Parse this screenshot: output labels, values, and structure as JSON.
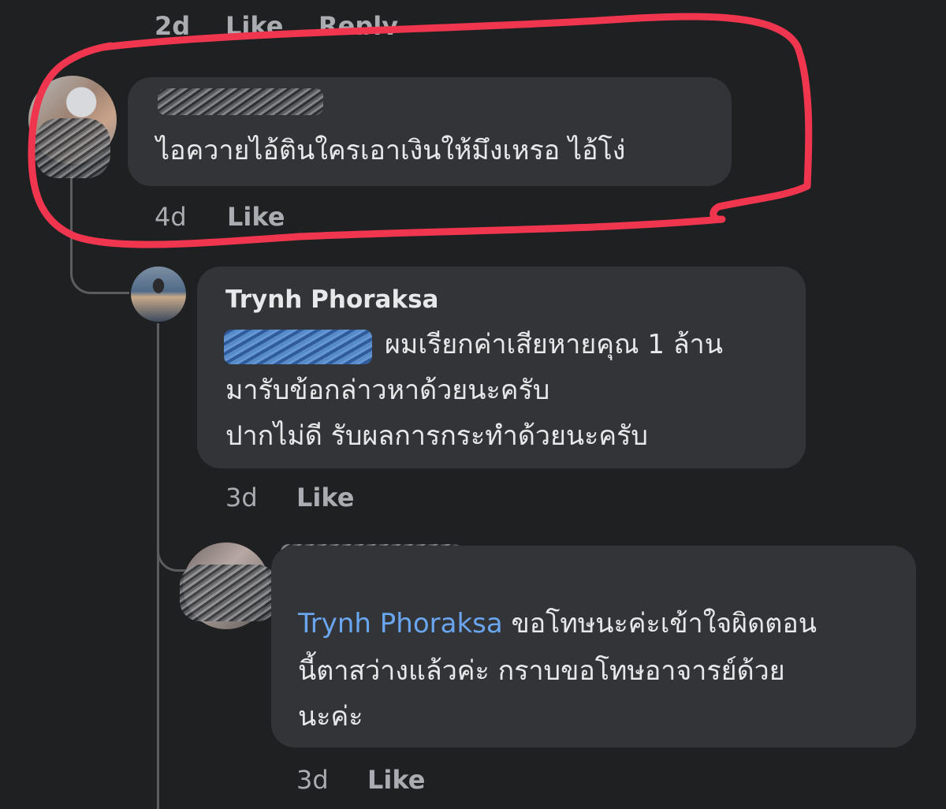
{
  "top_meta": {
    "time": "2d",
    "like_label": "Like",
    "reply_label": "Reply"
  },
  "comments": [
    {
      "author_redacted": true,
      "text_lines": [
        "ไอควายไอ้ตินใครเอาเงินให้มึงเหรอ ไอ้โง่"
      ],
      "time": "4d",
      "like_label": "Like",
      "highlighted": true
    },
    {
      "author": "Trynh Phoraksa",
      "mention_redacted": true,
      "text_lines": [
        "ผมเรียกค่าเสียหายคุณ 1 ล้าน",
        "มารับข้อกล่าวหาด้วยนะครับ",
        "ปากไม่ดี รับผลการกระทำด้วยนะครับ"
      ],
      "time": "3d",
      "like_label": "Like"
    },
    {
      "author_redacted": true,
      "mention": "Trynh Phoraksa",
      "text_lines": [
        " ขอโทษนะค่ะเข้าใจผิดตอน",
        "นี้ตาสว่างแล้วค่ะ  กราบขอโทษอาจารย์ด้วย",
        "นะค่ะ"
      ],
      "time": "3d",
      "like_label": "Like"
    }
  ],
  "colors": {
    "background": "#1f2022",
    "bubble": "#333437",
    "text": "#e6e8ea",
    "meta": "#a9acb0",
    "mention": "#6aa6f0",
    "highlight": "#f0354f"
  }
}
